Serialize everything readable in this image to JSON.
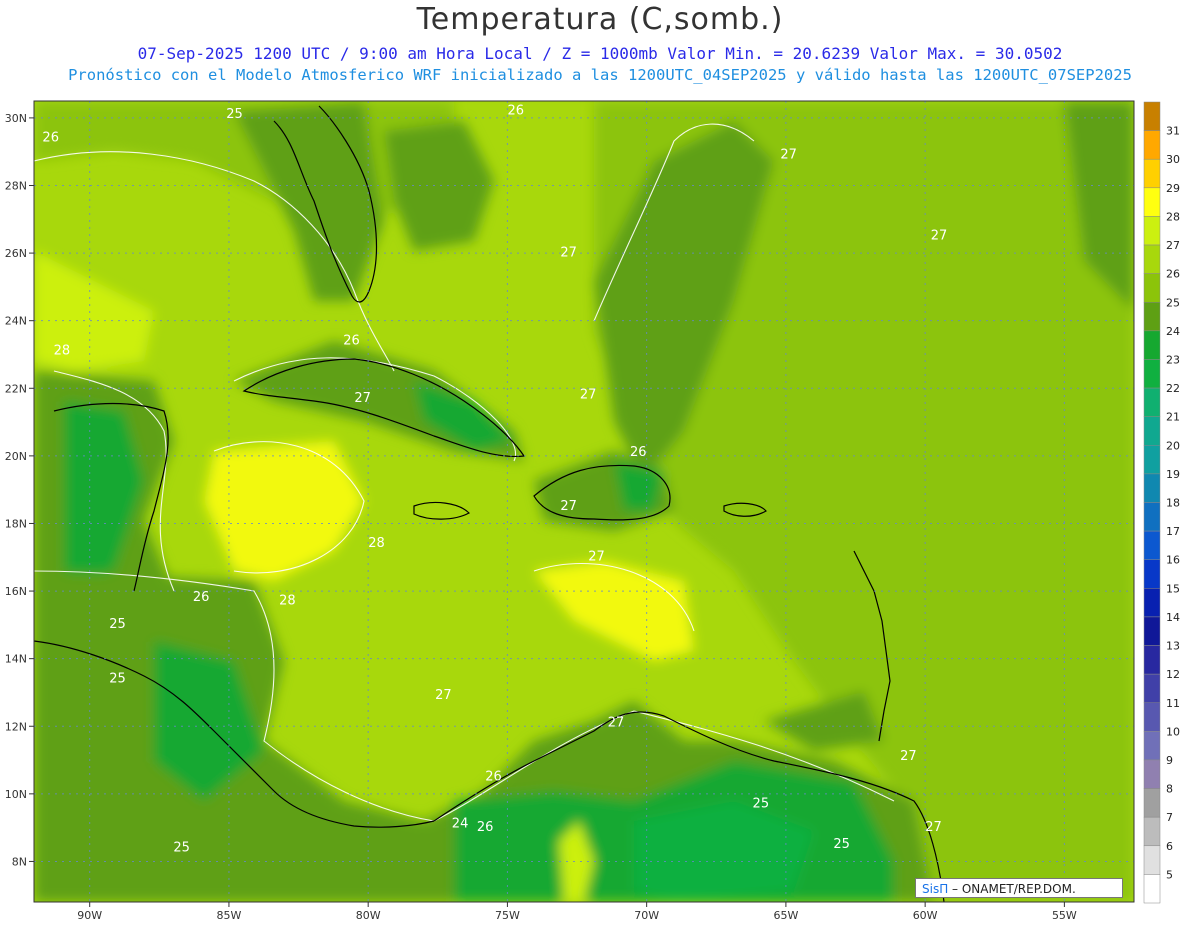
{
  "title": "Temperatura (C,somb.)",
  "subtitle_1": "07-Sep-2025  1200 UTC / 9:00 am Hora Local / Z = 1000mb   Valor Min. = 20.6239  Valor Max. = 30.0502",
  "subtitle_2": "Pronóstico con el Modelo Atmosferico WRF inicializado a las 1200UTC_04SEP2025 y válido hasta las  1200UTC_07SEP2025",
  "map": {
    "lon_range": [
      -92,
      -52.5
    ],
    "lat_range": [
      6.8,
      30.5
    ],
    "lon_ticks": [
      "90W",
      "85W",
      "80W",
      "75W",
      "70W",
      "65W",
      "60W",
      "55W"
    ],
    "lat_ticks": [
      "30N",
      "28N",
      "26N",
      "24N",
      "22N",
      "20N",
      "18N",
      "16N",
      "14N",
      "12N",
      "10N",
      "8N"
    ],
    "contour_labels": [
      {
        "text": "25",
        "lon": -84.8,
        "lat": 30.0
      },
      {
        "text": "26",
        "lon": -91.4,
        "lat": 29.3
      },
      {
        "text": "26",
        "lon": -74.7,
        "lat": 30.1
      },
      {
        "text": "27",
        "lon": -64.9,
        "lat": 28.8
      },
      {
        "text": "27",
        "lon": -59.5,
        "lat": 26.4
      },
      {
        "text": "27",
        "lon": -72.8,
        "lat": 25.9
      },
      {
        "text": "28",
        "lon": -91.0,
        "lat": 23.0
      },
      {
        "text": "26",
        "lon": -80.6,
        "lat": 23.3
      },
      {
        "text": "27",
        "lon": -80.2,
        "lat": 21.6
      },
      {
        "text": "27",
        "lon": -72.1,
        "lat": 21.7
      },
      {
        "text": "26",
        "lon": -70.3,
        "lat": 20.0
      },
      {
        "text": "27",
        "lon": -72.8,
        "lat": 18.4
      },
      {
        "text": "27",
        "lon": -71.8,
        "lat": 16.9
      },
      {
        "text": "28",
        "lon": -79.7,
        "lat": 17.3
      },
      {
        "text": "28",
        "lon": -82.9,
        "lat": 15.6
      },
      {
        "text": "26",
        "lon": -86.0,
        "lat": 15.7
      },
      {
        "text": "25",
        "lon": -89.0,
        "lat": 14.9
      },
      {
        "text": "25",
        "lon": -89.0,
        "lat": 13.3
      },
      {
        "text": "27",
        "lon": -77.3,
        "lat": 12.8
      },
      {
        "text": "27",
        "lon": -71.1,
        "lat": 12.0
      },
      {
        "text": "26",
        "lon": -75.5,
        "lat": 10.4
      },
      {
        "text": "25",
        "lon": -65.9,
        "lat": 9.6
      },
      {
        "text": "24",
        "lon": -76.7,
        "lat": 9.0
      },
      {
        "text": "26",
        "lon": -75.8,
        "lat": 8.9
      },
      {
        "text": "25",
        "lon": -86.7,
        "lat": 8.3
      },
      {
        "text": "25",
        "lon": -63.0,
        "lat": 8.4
      },
      {
        "text": "27",
        "lon": -60.6,
        "lat": 11.0
      },
      {
        "text": "27",
        "lon": -59.7,
        "lat": 8.9
      }
    ]
  },
  "colorbar": {
    "levels": [
      "5",
      "6",
      "7",
      "8",
      "9",
      "10",
      "11",
      "12",
      "13",
      "14",
      "15",
      "16",
      "17",
      "18",
      "19",
      "20",
      "21",
      "22",
      "23",
      "24",
      "25",
      "26",
      "27",
      "28",
      "29",
      "30",
      "31"
    ],
    "colors": [
      "#ffffff",
      "#e0e0e0",
      "#bcbcbc",
      "#a0a0a0",
      "#9080b0",
      "#7070b8",
      "#5858b0",
      "#4040a8",
      "#2828a0",
      "#101898",
      "#0820b0",
      "#0838c8",
      "#0c58d0",
      "#1070c0",
      "#1088b0",
      "#10a0a0",
      "#10a890",
      "#10b070",
      "#10b040",
      "#16a830",
      "#5ea014",
      "#8cc40a",
      "#a8d80c",
      "#ccf010",
      "#ffff10",
      "#ffd000",
      "#ffa800",
      "#c88000"
    ]
  },
  "credit": {
    "brand": "SisΠ",
    "org": " –  ONAMET/REP.DOM."
  }
}
